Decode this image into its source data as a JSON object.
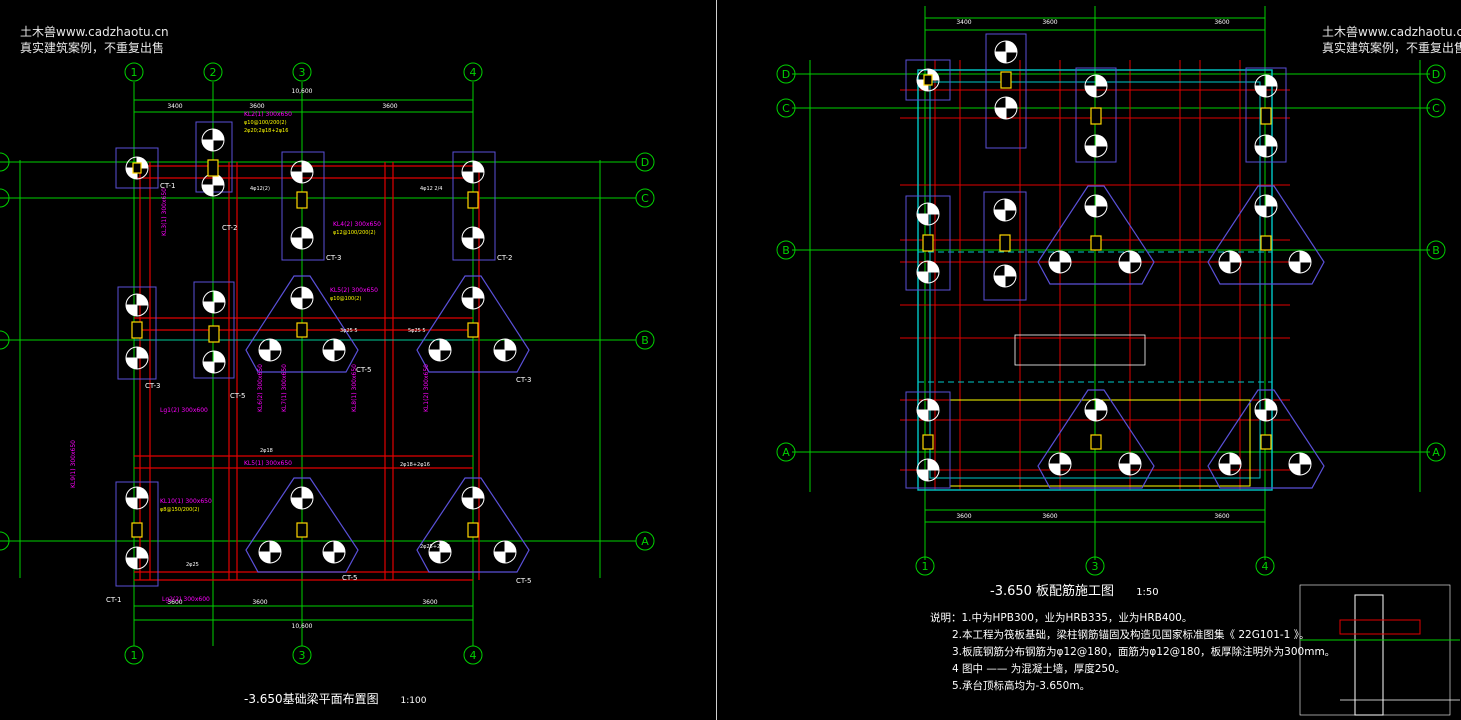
{
  "watermark": {
    "line1": "土木兽www.cadzhaotu.cn",
    "line2": "真实建筑案例，不重复出售"
  },
  "colors": {
    "background": "#000000",
    "axis": "#00d000",
    "beam": "#e00000",
    "footing": "#5a50d8",
    "pile": "#ffffff",
    "column": "#ffd700",
    "dim": "#00c8c8",
    "label_magenta": "#ff00ff",
    "label_yellow": "#ffff00"
  },
  "left_plan": {
    "title": "-3.650基础梁平面布置图",
    "scale": "1:100",
    "axis_top": [
      "1",
      "2",
      "3",
      "4"
    ],
    "axis_bottom": [
      "1",
      "3",
      "4"
    ],
    "axis_right": [
      "D",
      "C",
      "B",
      "A"
    ],
    "dims_top": [
      "3400",
      "3600",
      "3600"
    ],
    "dims_bottom": [
      "3600",
      "3600",
      "3600"
    ],
    "overall": "10,600",
    "labels_ct": [
      "CT-1",
      "CT-2",
      "CT-3",
      "CT-2",
      "CT-3",
      "CT-5",
      "CT-5",
      "CT-3",
      "CT-1",
      "CT-5",
      "CT-5"
    ],
    "beam_labels": [
      "KL2(1) 300x650",
      "KL3(1) 300x650",
      "KL4(2) 300x650",
      "KL5(2) 300x650",
      "KL6(2) 300x650",
      "KL7(1) 300x650",
      "KL8(1) 300x650",
      "KL1(2) 300x650",
      "KL9(1) 300x650",
      "Lg1(2) 300x600",
      "Lg2(2) 300x600",
      "KL10(1) 300x650"
    ]
  },
  "right_plan": {
    "title": "-3.650  板配筋施工图",
    "scale": "1:50",
    "axis_top": [
      "1",
      "3",
      "4"
    ],
    "axis_right": [
      "D",
      "C",
      "B",
      "A"
    ],
    "dims_top": [
      "3400",
      "3600",
      "3600"
    ],
    "dims_bottom": [
      "3600",
      "3600",
      "3600"
    ],
    "notes": [
      "说明：1.中为HPB300，业为HRB335，业为HRB400。",
      "2.本工程为筏板基础，梁柱钢筋锚固及构造见国家标准图集《        22G101-1     》。",
      "3.板底钢筋分布钢筋为φ12@180，面筋为φ12@180，板厚除注明外为300mm。",
      "4  图中  ——  为混凝土墙，厚度250。",
      "5.承台顶标高均为-3.650m。"
    ]
  }
}
